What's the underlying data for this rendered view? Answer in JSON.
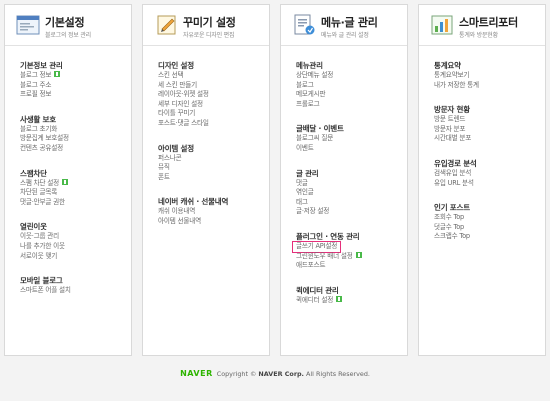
{
  "columns": [
    {
      "title": "기본설정",
      "subtitle": "블로그의 정보 관리",
      "icon": "basic-settings-window-icon",
      "sections": [
        {
          "title": "기본정보 관리",
          "items": [
            {
              "label": "블로그 정보",
              "new": true
            },
            {
              "label": "블로그 주소"
            },
            {
              "label": "프로필 정보"
            }
          ]
        },
        {
          "title": "사생활 보호",
          "items": [
            {
              "label": "블로그 초기화"
            },
            {
              "label": "방문집계 보호설정"
            },
            {
              "label": "컨텐츠 공유설정"
            }
          ]
        },
        {
          "title": "스팸차단",
          "items": [
            {
              "label": "스팸 차단 설정",
              "new": true
            },
            {
              "label": "차단된 글목록"
            },
            {
              "label": "댓글·안부글 권한"
            }
          ]
        },
        {
          "title": "열린이웃",
          "items": [
            {
              "label": "이웃·그룹 관리"
            },
            {
              "label": "나를 추가한 이웃"
            },
            {
              "label": "서로이웃 맺기"
            }
          ]
        },
        {
          "title": "모바일 블로그",
          "items": [
            {
              "label": "스마트폰 어플 설치"
            }
          ]
        }
      ]
    },
    {
      "title": "꾸미기 설정",
      "subtitle": "자유로운 디자인 편집",
      "icon": "design-palette-icon",
      "sections": [
        {
          "title": "디자인 설정",
          "items": [
            {
              "label": "스킨 선택"
            },
            {
              "label": "세 스킨 만들기"
            },
            {
              "label": "레이아웃·위젯 설정"
            },
            {
              "label": "세부 디자인 설정"
            },
            {
              "label": "타이틀 꾸미기"
            },
            {
              "label": "포스트·댓글 스타일"
            }
          ]
        },
        {
          "title": "아이템 설정",
          "items": [
            {
              "label": "퍼스나콘"
            },
            {
              "label": "뮤직"
            },
            {
              "label": "폰트"
            }
          ]
        },
        {
          "title": "네이버 캐쉬 · 선물내역",
          "items": [
            {
              "label": "캐쉬 이용내역"
            },
            {
              "label": "아이템 선물내역"
            }
          ]
        }
      ]
    },
    {
      "title": "메뉴·글 관리",
      "subtitle": "메뉴와 글 관리 설정",
      "icon": "menu-document-icon",
      "sections": [
        {
          "title": "메뉴관리",
          "items": [
            {
              "label": "상단메뉴 설정"
            },
            {
              "label": "블로그"
            },
            {
              "label": "메모게시판"
            },
            {
              "label": "프롤로그"
            }
          ]
        },
        {
          "title": "글배달 · 이벤트",
          "items": [
            {
              "label": "블로그씨 질문"
            },
            {
              "label": "이벤트"
            }
          ]
        },
        {
          "title": "글 관리",
          "items": [
            {
              "label": "댓글"
            },
            {
              "label": "엮인글"
            },
            {
              "label": "태그"
            },
            {
              "label": "글·저장 설정"
            }
          ]
        },
        {
          "title": "플러그인 · 연동 관리",
          "items": [
            {
              "label": "글쓰기 API설정",
              "highlight": true
            },
            {
              "label": "그린윈도우 배너 설정",
              "new": true
            },
            {
              "label": "애드포스트"
            }
          ]
        },
        {
          "title": "퀵에디터 관리",
          "items": [
            {
              "label": "퀵에디터 설정",
              "new": true
            }
          ]
        }
      ]
    },
    {
      "title": "스마트리포터",
      "subtitle": "통계와 방문현황",
      "icon": "smart-reporter-chart-icon",
      "sections": [
        {
          "title": "통계요약",
          "items": [
            {
              "label": "통계요약보기"
            },
            {
              "label": "내가 저장한 통계"
            }
          ]
        },
        {
          "title": "방문자 현황",
          "items": [
            {
              "label": "방문 트렌드"
            },
            {
              "label": "방문자 분포"
            },
            {
              "label": "시간대별 분포"
            }
          ]
        },
        {
          "title": "유입경로 분석",
          "items": [
            {
              "label": "검색유입 분석"
            },
            {
              "label": "유입 URL 분석"
            }
          ]
        },
        {
          "title": "인기 포스트",
          "items": [
            {
              "label": "조회수 Top"
            },
            {
              "label": "덧글수 Top"
            },
            {
              "label": "스크랩수 Top"
            }
          ]
        }
      ]
    }
  ],
  "footer": {
    "logo": "NAVER",
    "copyright_prefix": "Copyright © ",
    "company": "NAVER Corp.",
    "rights": " All Rights Reserved."
  },
  "colors": {
    "highlight_border": "#e52f7a",
    "new_badge": "#49b949",
    "naver_green": "#2db400"
  }
}
